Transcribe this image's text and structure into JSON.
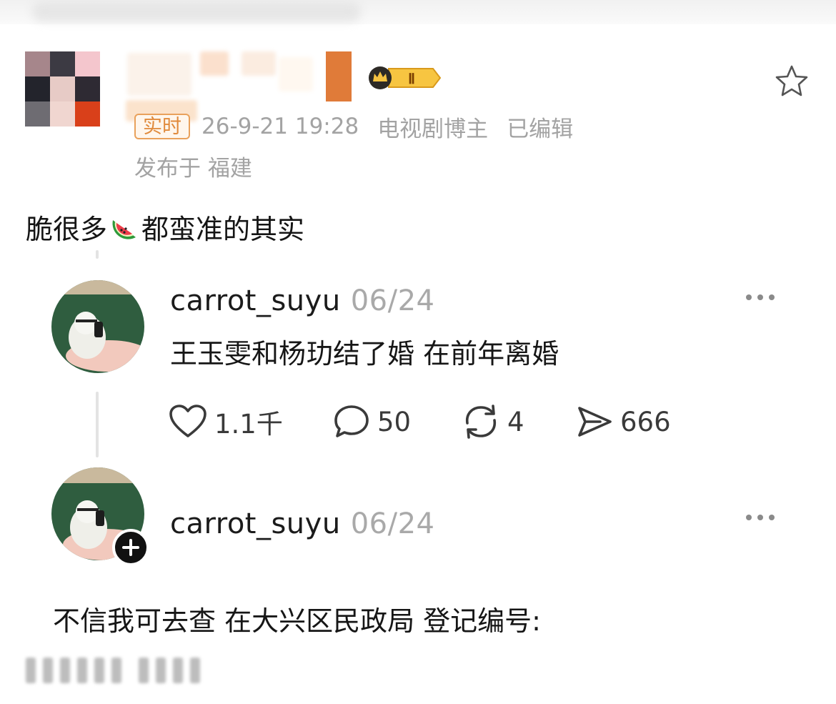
{
  "post": {
    "live_badge": "实时",
    "timestamp": "26-9-21 19:28",
    "author_tag": "电视剧博主",
    "edited": "已编辑",
    "location": "发布于 福建",
    "text_before_emoji": "脆很多",
    "emoji": "watermelon",
    "text_after_emoji": "都蛮准的其实",
    "favorite_icon": "star-outline-icon",
    "badge_icon": "crown-level-badge-icon",
    "badge_label": "Ⅱ"
  },
  "comments": [
    {
      "username": "carrot_suyu",
      "date": "06/24",
      "text": "王玉雯和杨玏结了婚 在前年离婚",
      "stats": {
        "likes": "1.1千",
        "comments": "50",
        "reposts": "4",
        "shares": "666"
      }
    },
    {
      "username": "carrot_suyu",
      "date": "06/24",
      "text": "不信我可去查 在大兴区民政局 登记编号:"
    }
  ],
  "colors": {
    "accent_orange": "#e08a3c",
    "meta_gray": "#a3a3a3",
    "text_dark": "#151515"
  }
}
